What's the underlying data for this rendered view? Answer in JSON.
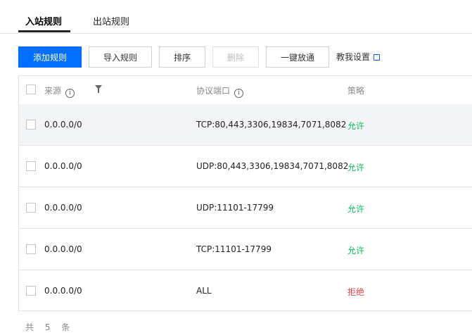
{
  "tabs": [
    {
      "label": "入站规则",
      "active": true
    },
    {
      "label": "出站规则",
      "active": false
    }
  ],
  "toolbar": {
    "add": "添加规则",
    "import": "导入规则",
    "sort": "排序",
    "delete": "删除",
    "one_click": "一键放通",
    "help": "教我设置"
  },
  "table": {
    "headers": {
      "source": "来源",
      "port": "协议端口",
      "policy": "策略"
    },
    "rows": [
      {
        "source": "0.0.0.0/0",
        "port": "TCP:80,443,3306,19834,7071,8082",
        "policy": "允许"
      },
      {
        "source": "0.0.0.0/0",
        "port": "UDP:80,443,3306,19834,7071,8082",
        "policy": "允许"
      },
      {
        "source": "0.0.0.0/0",
        "port": "UDP:11101-17799",
        "policy": "允许"
      },
      {
        "source": "0.0.0.0/0",
        "port": "TCP:11101-17799",
        "policy": "允许"
      },
      {
        "source": "0.0.0.0/0",
        "port": "ALL",
        "policy": "拒绝"
      }
    ]
  },
  "footer": "共 5 条",
  "colors": {
    "primary": "#006eff",
    "allow": "#0abf5b",
    "deny": "#e54545"
  }
}
